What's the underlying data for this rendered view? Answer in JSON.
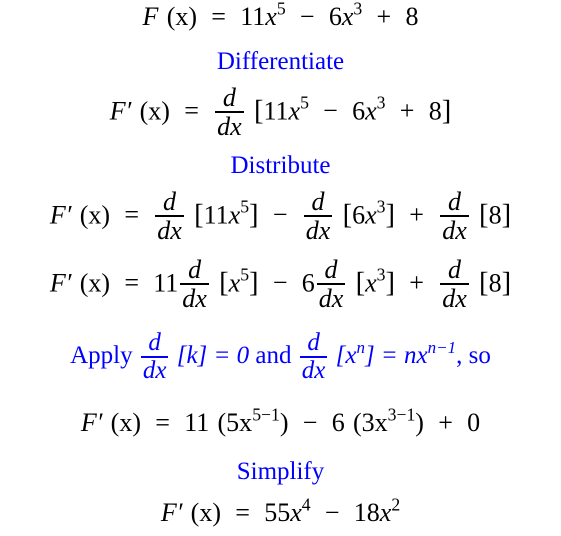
{
  "colors": {
    "math": "#000000",
    "annotation": "#0000ff"
  },
  "steps": {
    "given": {
      "lhs": "F",
      "arg": "(x)",
      "eq": "=",
      "c1": "11",
      "v1": "x",
      "e1": "5",
      "op1": "−",
      "c2": "6",
      "v2": "x",
      "e2": "3",
      "op2": "+",
      "c3": "8"
    },
    "note_differentiate": "Differentiate",
    "diff": {
      "lhs": "F′",
      "arg": "(x)",
      "eq": "=",
      "d": "d",
      "dx": "dx",
      "open": "[",
      "c1": "11",
      "v1": "x",
      "e1": "5",
      "op1": "−",
      "c2": "6",
      "v2": "x",
      "e2": "3",
      "op2": "+",
      "c3": "8",
      "close": "]"
    },
    "note_distribute": "Distribute",
    "distribute": {
      "lhs": "F′",
      "arg": "(x)",
      "eq": "=",
      "d": "d",
      "dx": "dx",
      "t1": "11",
      "v1": "x",
      "e1": "5",
      "op1": "−",
      "t2": "6",
      "v2": "x",
      "e2": "3",
      "op2": "+",
      "t3": "8"
    },
    "constants": {
      "lhs": "F′",
      "arg": "(x)",
      "eq": "=",
      "d": "d",
      "dx": "dx",
      "k1": "11",
      "v1": "x",
      "e1": "5",
      "op1": "−",
      "k2": "6",
      "v2": "x",
      "e2": "3",
      "op2": "+",
      "t3": "8"
    },
    "note_apply": {
      "prefix": "Apply",
      "d": "d",
      "dx": "dx",
      "rule1": "[k] = 0",
      "and": "and",
      "rule2_base": "[x",
      "rule2_exp": "n",
      "rule2_mid": "] = nx",
      "rule2_result_exp": "n−1",
      "suffix": ",  so"
    },
    "applied": {
      "lhs": "F′",
      "arg": "(x)",
      "eq": "=",
      "k1": "11",
      "p1": "(5x",
      "e1": "5−1",
      "op1": "−",
      "k2": "6",
      "p2": "(3x",
      "e2": "3−1",
      "close": ")",
      "op2": "+",
      "c3": "0"
    },
    "note_simplify": "Simplify",
    "result": {
      "lhs": "F′",
      "arg": "(x)",
      "eq": "=",
      "c1": "55",
      "v1": "x",
      "e1": "4",
      "op1": "−",
      "c2": "18",
      "v2": "x",
      "e2": "2"
    }
  }
}
